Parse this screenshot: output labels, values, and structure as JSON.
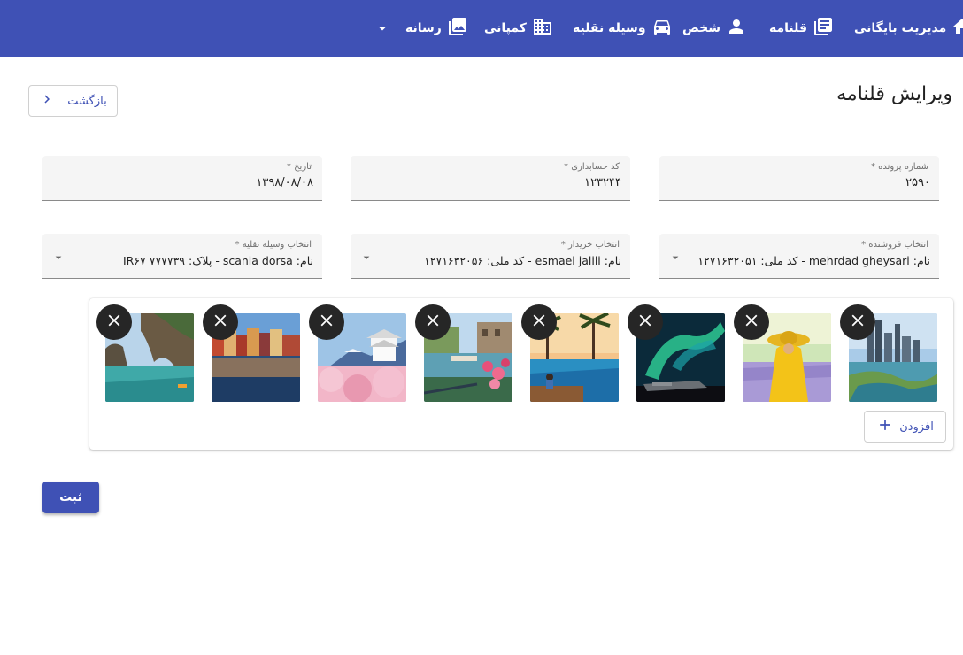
{
  "nav": {
    "archive": "مدیریت بایگانی",
    "pen": "قلنامه",
    "person": "شخص",
    "vehicle": "وسیله نقلیه",
    "company": "کمپانی",
    "media": "رسانه"
  },
  "page": {
    "title": "ویرایش قلنامه",
    "back": "بازگشت"
  },
  "fields": {
    "case_number": {
      "label": "شماره پرونده *",
      "value": "۲۵۹۰"
    },
    "accounting_code": {
      "label": "کد حسابداری *",
      "value": "۱۲۳۲۴۴"
    },
    "date": {
      "label": "تاریخ *",
      "value": "۱۳۹۸/۰۸/۰۸"
    },
    "seller": {
      "label": "انتخاب فروشنده *",
      "value": "نام: mehrdad gheysari - کد ملی: ۱۲۷۱۶۳۲۰۵۱"
    },
    "buyer": {
      "label": "انتخاب خریدار *",
      "value": "نام: esmael jalili - کد ملی: ۱۲۷۱۶۳۲۰۵۶"
    },
    "vehicle": {
      "label": "انتخاب وسیله نقلیه *",
      "value": "نام: scania dorsa - پلاک: IR۶۷ ۷۷۷۷۳۹"
    }
  },
  "gallery": {
    "add_label": "افزودن",
    "images": [
      "city-skyline",
      "lavender-field",
      "aurora-plane",
      "resort-pool",
      "canal-flowers",
      "japanese-castle",
      "harbor-night",
      "sea-cliffs"
    ]
  },
  "submit": "ثبت",
  "colors": {
    "primary": "#3f51b5",
    "field_bg": "#f5f5f5",
    "remove_bg": "#262626"
  }
}
